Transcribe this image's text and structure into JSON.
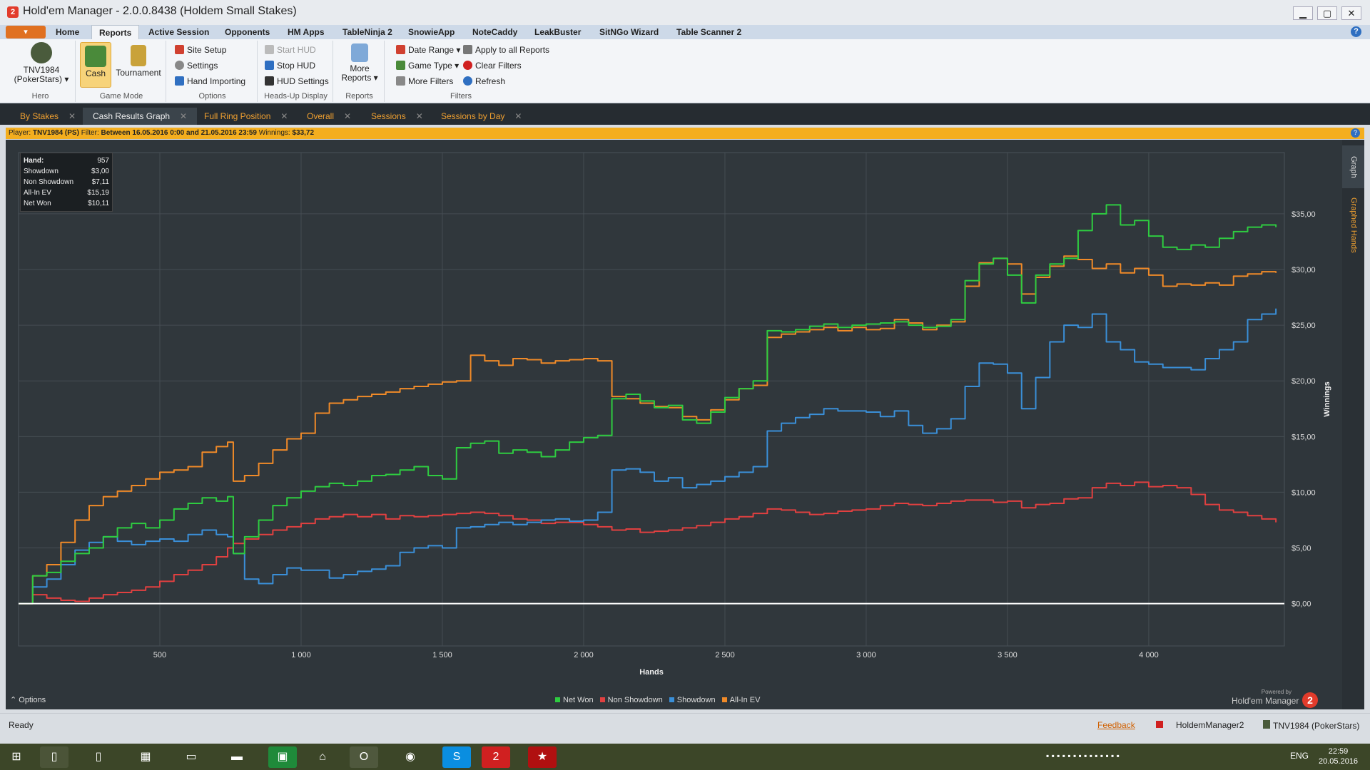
{
  "window": {
    "title": "Hold'em Manager - 2.0.0.8438 (Holdem Small Stakes)",
    "btn_min": "▁",
    "btn_max": "▢",
    "btn_close": "✕"
  },
  "menu": {
    "app_button": "▾",
    "tabs": [
      "Home",
      "Reports",
      "Active Session",
      "Opponents",
      "HM Apps",
      "TableNinja 2",
      "SnowieApp",
      "NoteCaddy",
      "LeakBuster",
      "SitNGo Wizard",
      "Table Scanner 2"
    ],
    "help": "?"
  },
  "ribbon": {
    "hero": {
      "name": "TNV1984",
      "site": "(PokerStars) ▾",
      "group": "Hero"
    },
    "game_mode": {
      "cash": "Cash",
      "tournament": "Tournament",
      "group": "Game Mode"
    },
    "options": {
      "site_setup": "Site Setup",
      "settings": "Settings",
      "hand_importing": "Hand Importing",
      "group": "Options"
    },
    "hud": {
      "start": "Start HUD",
      "stop": "Stop HUD",
      "settings": "HUD Settings",
      "group": "Heads-Up Display"
    },
    "reports": {
      "more1": "More",
      "more2": "Reports ▾",
      "group": "Reports"
    },
    "filters": {
      "date_range": "Date Range ▾",
      "game_type": "Game Type ▾",
      "more_filters": "More Filters",
      "apply_all": "Apply to all Reports",
      "clear": "Clear Filters",
      "refresh": "Refresh",
      "group": "Filters"
    }
  },
  "doc_tabs": [
    "By Stakes",
    "Cash Results Graph",
    "Full Ring Position",
    "Overall",
    "Sessions",
    "Sessions by Day"
  ],
  "filter_bar": {
    "player_label": "Player:",
    "player": "TNV1984 (PS)",
    "filter_label": "Filter:",
    "filter": "Between 16.05.2016 0:00 and 21.05.2016 23:59",
    "winnings_label": "Winnings:",
    "winnings": "$33,72"
  },
  "stats_box": [
    {
      "label": "Hand:",
      "value": "957"
    },
    {
      "label": "Showdown",
      "value": "$3,00"
    },
    {
      "label": "Non Showdown",
      "value": "$7,11"
    },
    {
      "label": "All-In EV",
      "value": "$15,19"
    },
    {
      "label": "Net Won",
      "value": "$10,11"
    }
  ],
  "side_tabs": {
    "graph": "Graph",
    "graphed_hands": "Graphed Hands"
  },
  "graph_options": "⌃  Options",
  "powered": {
    "line1": "Powered by",
    "line2": "Hold'em Manager",
    "badge": "2"
  },
  "colors": {
    "net_won": "#2ecc40",
    "non_showdown": "#e04040",
    "showdown": "#3a8fd8",
    "all_in_ev": "#f08a28",
    "zero_line": "#ffffff"
  },
  "chart_data": {
    "type": "line",
    "xlabel": "Hands",
    "ylabel": "Winnings",
    "xlim": [
      0,
      4480
    ],
    "ylim": [
      -3.8,
      40.5
    ],
    "x_ticks": [
      500,
      1000,
      1500,
      2000,
      2500,
      3000,
      3500,
      4000
    ],
    "x_tick_labels": [
      "500",
      "1 000",
      "1 500",
      "2 000",
      "2 500",
      "3 000",
      "3 500",
      "4 000"
    ],
    "y_ticks": [
      0,
      5,
      10,
      15,
      20,
      25,
      30,
      35
    ],
    "y_tick_labels": [
      "$0,00",
      "$5,00",
      "$10,00",
      "$15,00",
      "$20,00",
      "$25,00",
      "$30,00",
      "$35,00"
    ],
    "x": [
      0,
      50,
      100,
      150,
      200,
      250,
      300,
      350,
      400,
      450,
      500,
      550,
      600,
      650,
      700,
      740,
      760,
      800,
      850,
      900,
      950,
      1000,
      1050,
      1100,
      1150,
      1200,
      1250,
      1300,
      1350,
      1400,
      1450,
      1500,
      1550,
      1600,
      1650,
      1700,
      1750,
      1800,
      1850,
      1900,
      1950,
      2000,
      2050,
      2100,
      2150,
      2200,
      2250,
      2300,
      2350,
      2400,
      2450,
      2500,
      2550,
      2600,
      2650,
      2700,
      2750,
      2800,
      2850,
      2900,
      2950,
      3000,
      3050,
      3100,
      3150,
      3200,
      3250,
      3300,
      3350,
      3400,
      3450,
      3500,
      3550,
      3600,
      3650,
      3700,
      3750,
      3800,
      3850,
      3900,
      3950,
      4000,
      4050,
      4100,
      4150,
      4200,
      4250,
      4300,
      4350,
      4400,
      4450
    ],
    "series": [
      {
        "name": "Net Won",
        "color": "#2ecc40",
        "values": [
          0,
          2.5,
          2.8,
          3.8,
          4.5,
          5.0,
          6.0,
          6.8,
          7.2,
          6.8,
          7.5,
          8.5,
          9.0,
          9.5,
          9.2,
          9.6,
          4.5,
          6.0,
          7.5,
          8.8,
          9.5,
          10.1,
          10.5,
          10.8,
          10.6,
          11.0,
          11.5,
          11.6,
          12.0,
          12.3,
          11.5,
          11.2,
          14.0,
          14.4,
          14.6,
          13.5,
          13.8,
          13.6,
          13.2,
          13.8,
          14.5,
          14.9,
          15.1,
          18.4,
          18.8,
          18.2,
          17.6,
          17.8,
          16.5,
          16.2,
          17.2,
          18.5,
          19.3,
          20.0,
          24.5,
          24.4,
          24.6,
          24.9,
          25.1,
          24.8,
          25.0,
          25.1,
          25.2,
          25.3,
          25.0,
          24.8,
          24.9,
          25.5,
          29.0,
          30.5,
          31.0,
          29.5,
          27.0,
          29.5,
          30.5,
          31.0,
          33.5,
          35.0,
          35.8,
          34.0,
          34.4,
          33.0,
          32.0,
          31.8,
          32.2,
          32.0,
          32.8,
          33.4,
          33.8,
          34.0,
          33.8
        ]
      },
      {
        "name": "Non Showdown",
        "color": "#e04040",
        "values": [
          0,
          0.8,
          0.5,
          0.3,
          0.2,
          0.5,
          0.8,
          1.0,
          1.2,
          1.5,
          2.0,
          2.6,
          3.0,
          3.5,
          4.2,
          5.0,
          5.4,
          5.8,
          6.2,
          6.6,
          6.9,
          7.2,
          7.6,
          7.8,
          8.0,
          7.8,
          8.0,
          7.6,
          7.9,
          7.8,
          7.9,
          8.0,
          8.1,
          8.2,
          8.1,
          7.9,
          7.6,
          7.5,
          7.2,
          7.3,
          7.3,
          7.1,
          6.9,
          6.6,
          6.7,
          6.4,
          6.5,
          6.6,
          6.8,
          7.0,
          7.3,
          7.6,
          7.8,
          8.1,
          8.5,
          8.4,
          8.2,
          8.0,
          8.1,
          8.3,
          8.4,
          8.5,
          8.8,
          9.0,
          8.9,
          8.8,
          9.0,
          9.2,
          9.3,
          9.3,
          9.1,
          9.2,
          8.6,
          8.9,
          9.0,
          9.4,
          9.5,
          10.4,
          10.8,
          10.6,
          10.9,
          10.5,
          10.6,
          10.4,
          9.8,
          8.9,
          8.4,
          8.2,
          7.9,
          7.6,
          7.3
        ]
      },
      {
        "name": "Showdown",
        "color": "#3a8fd8",
        "values": [
          0,
          1.5,
          2.2,
          3.5,
          4.8,
          5.5,
          6.0,
          5.6,
          5.3,
          5.6,
          5.8,
          5.6,
          6.2,
          6.6,
          6.2,
          6.0,
          4.5,
          2.2,
          1.8,
          2.6,
          3.2,
          3.0,
          3.0,
          2.3,
          2.6,
          2.9,
          3.1,
          3.4,
          4.6,
          5.0,
          5.2,
          5.0,
          6.8,
          6.9,
          7.1,
          7.3,
          7.1,
          7.3,
          7.5,
          7.6,
          7.4,
          7.5,
          8.2,
          12.0,
          12.1,
          11.8,
          11.0,
          11.3,
          10.4,
          10.7,
          11.0,
          11.4,
          11.8,
          12.3,
          15.5,
          16.2,
          16.7,
          17.0,
          17.5,
          17.3,
          17.3,
          17.2,
          16.8,
          17.3,
          16.0,
          15.3,
          15.7,
          16.6,
          19.5,
          21.6,
          21.5,
          20.7,
          17.5,
          20.3,
          23.5,
          25.0,
          24.8,
          26.0,
          23.5,
          22.8,
          21.7,
          21.5,
          21.2,
          21.2,
          21.0,
          22.0,
          22.8,
          23.5,
          25.5,
          26.0,
          26.5
        ]
      },
      {
        "name": "All-In EV",
        "color": "#f08a28",
        "values": [
          0,
          2.5,
          3.5,
          5.5,
          7.5,
          8.8,
          9.6,
          10.1,
          10.6,
          11.2,
          11.8,
          12.0,
          12.3,
          13.6,
          14.1,
          14.5,
          11.0,
          11.5,
          12.6,
          13.8,
          14.8,
          15.3,
          17.1,
          18.0,
          18.3,
          18.6,
          18.8,
          19.0,
          19.3,
          19.5,
          19.7,
          19.9,
          20.0,
          22.3,
          21.8,
          21.4,
          22.0,
          21.9,
          21.6,
          21.8,
          21.9,
          22.0,
          21.8,
          18.6,
          18.4,
          18.0,
          17.7,
          17.6,
          16.8,
          16.5,
          17.4,
          18.3,
          19.3,
          19.6,
          23.9,
          24.2,
          24.4,
          24.6,
          24.8,
          24.5,
          24.8,
          24.6,
          24.7,
          25.5,
          25.2,
          24.6,
          25.0,
          25.3,
          28.5,
          30.6,
          31.0,
          30.5,
          27.8,
          29.3,
          30.3,
          31.2,
          30.9,
          30.1,
          30.5,
          29.7,
          30.1,
          29.5,
          28.5,
          28.7,
          28.6,
          28.8,
          28.6,
          29.4,
          29.6,
          29.8,
          29.7
        ]
      }
    ]
  },
  "legend": [
    "Net Won",
    "Non Showdown",
    "Showdown",
    "All-In EV"
  ],
  "status": {
    "ready": "Ready",
    "feedback": "Feedback",
    "hm2": "HoldemManager2",
    "hero": "TNV1984 (PokerStars)"
  },
  "taskbar": {
    "lang": "ENG",
    "time": "22:59",
    "date": "20.05.2016"
  }
}
